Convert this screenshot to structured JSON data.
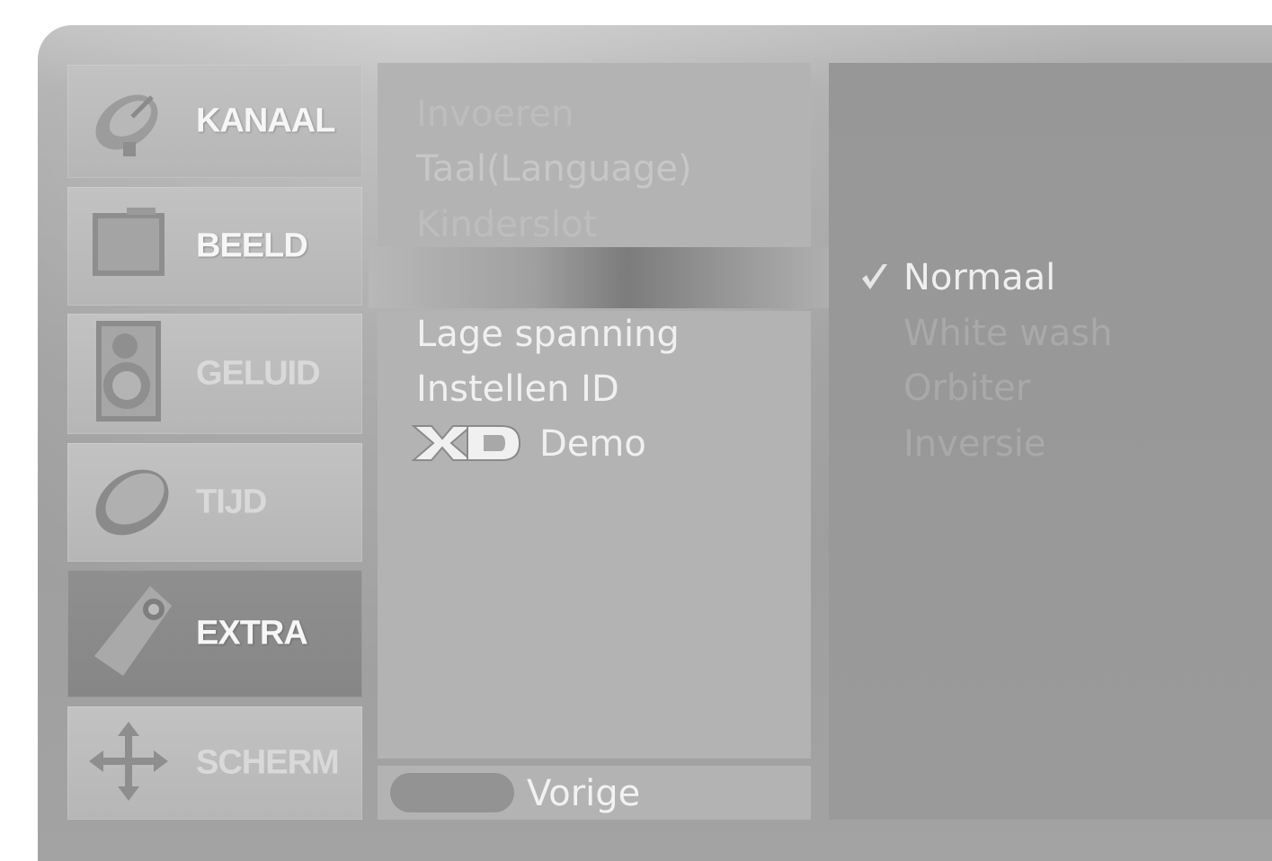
{
  "categories": [
    {
      "label": "KANAAL",
      "icon": "satellite-dish-icon",
      "selected": false
    },
    {
      "label": "BEELD",
      "icon": "picture-icon",
      "selected": false
    },
    {
      "label": "GELUID",
      "icon": "speaker-icon",
      "selected": false
    },
    {
      "label": "TIJD",
      "icon": "clock-icon",
      "selected": false
    },
    {
      "label": "EXTRA",
      "icon": "tag-icon",
      "selected": true
    },
    {
      "label": "SCHERM",
      "icon": "move-arrows-icon",
      "selected": false
    }
  ],
  "menu": {
    "items_top": [
      "Invoeren",
      "Taal(Language)",
      "Kinderslot"
    ],
    "items_main": [
      "Lage spanning",
      "Instellen ID"
    ],
    "xd_demo_label": "Demo",
    "xd_logo_text": "XD"
  },
  "footer": {
    "back_label": "Vorige"
  },
  "options": {
    "selected": "Normaal",
    "items": [
      "Normaal",
      "White wash",
      "Orbiter",
      "Inversie"
    ]
  },
  "colors": {
    "panel": "#b3b3b3",
    "selected_tab": "#8a8a8a",
    "right_panel": "#989898",
    "text_light": "#f0f0f0"
  }
}
